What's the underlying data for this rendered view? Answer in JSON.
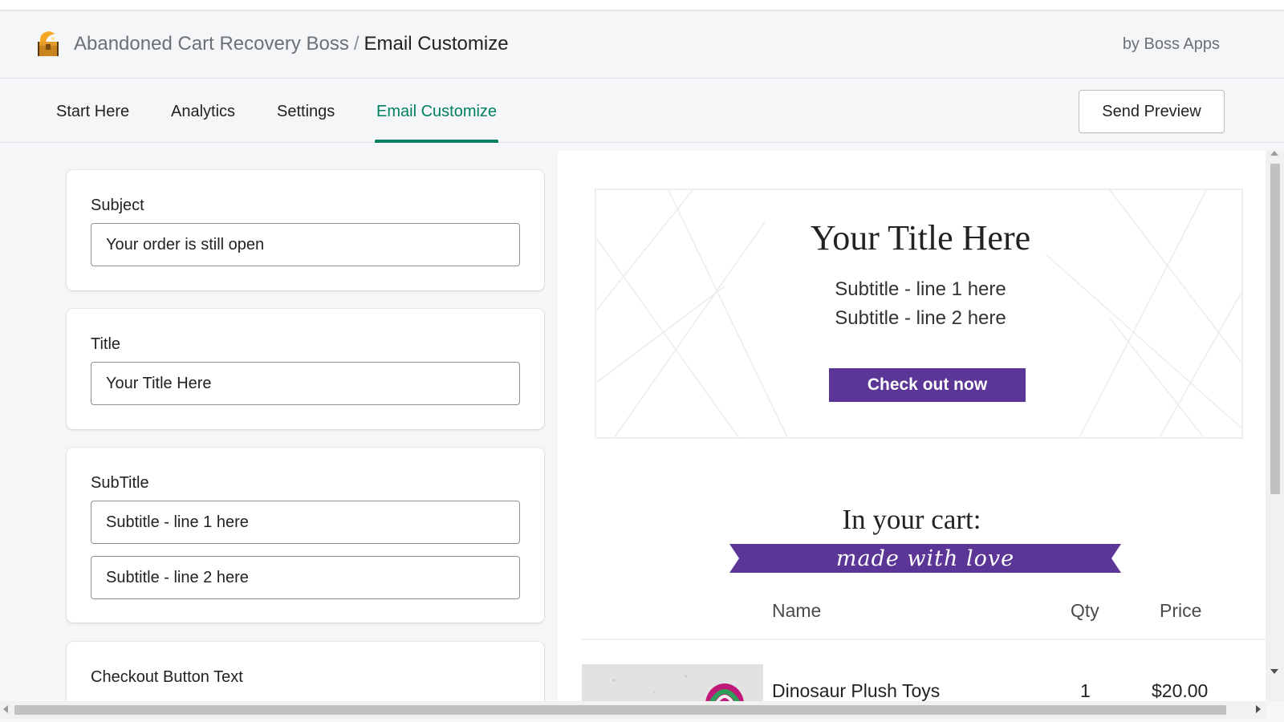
{
  "header": {
    "app_name": "Abandoned Cart Recovery Boss",
    "separator": "/",
    "page_name": "Email Customize",
    "vendor": "by Boss Apps",
    "logo_icon": "treasure-chest-icon"
  },
  "tabs": [
    {
      "label": "Start Here",
      "active": false
    },
    {
      "label": "Analytics",
      "active": false
    },
    {
      "label": "Settings",
      "active": false
    },
    {
      "label": "Email Customize",
      "active": true
    }
  ],
  "actions": {
    "send_preview": "Send Preview"
  },
  "form": {
    "subject": {
      "label": "Subject",
      "value": "Your order is still open"
    },
    "title": {
      "label": "Title",
      "value": "Your Title Here"
    },
    "subtitle": {
      "label": "SubTitle",
      "line1": "Subtitle - line 1 here",
      "line2": "Subtitle - line 2 here"
    },
    "checkout_button": {
      "label": "Checkout Button Text"
    }
  },
  "preview": {
    "title": "Your Title Here",
    "subtitle_line1": "Subtitle - line 1 here",
    "subtitle_line2": "Subtitle - line 2 here",
    "checkout_label": "Check out now",
    "cart_heading": "In your cart:",
    "ribbon_text": "made with love",
    "columns": {
      "name": "Name",
      "qty": "Qty",
      "price": "Price"
    },
    "items": [
      {
        "name": "Dinosaur Plush Toys",
        "qty": "1",
        "price": "$20.00"
      }
    ]
  },
  "colors": {
    "accent": "#008060",
    "brand_purple": "#5c3696",
    "heart": "#d0021b"
  }
}
